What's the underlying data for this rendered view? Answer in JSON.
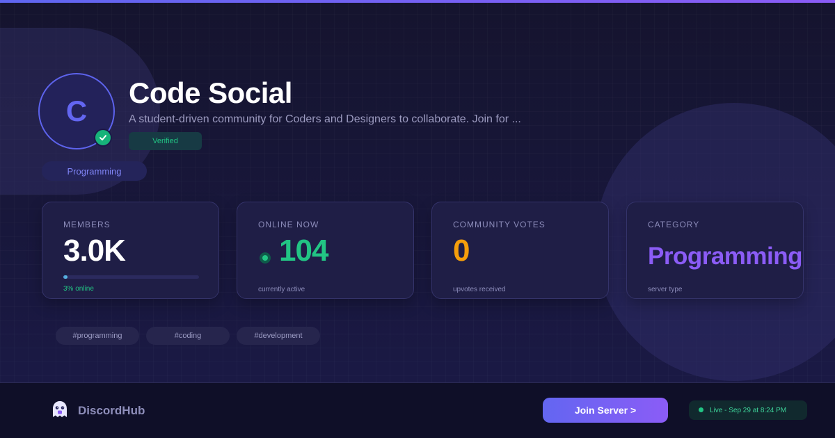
{
  "server": {
    "avatar_letter": "C",
    "name": "Code Social",
    "description": "A student-driven community for Coders and Designers to collaborate. Join for ...",
    "verified_label": "Verified",
    "category_pill": "Programming"
  },
  "stats": {
    "members": {
      "label": "MEMBERS",
      "value": "3.0K",
      "sub": "3% online",
      "online_fraction": 0.03
    },
    "online": {
      "label": "ONLINE NOW",
      "value": "104",
      "sub": "currently active"
    },
    "votes": {
      "label": "COMMUNITY VOTES",
      "value": "0",
      "sub": "upvotes received"
    },
    "category": {
      "label": "CATEGORY",
      "value": "Programming",
      "sub": "server type"
    }
  },
  "tags": [
    "#programming",
    "#coding",
    "#development"
  ],
  "footer": {
    "brand_name": "DiscordHub",
    "join_label": "Join Server >",
    "live_text": "Live - Sep 29 at 8:24 PM"
  },
  "colors": {
    "accent": "#6366f1",
    "accent_purple": "#8b5cf6",
    "online_green": "#22c584",
    "votes_orange": "#f59e0b",
    "category_purple": "#8b5cf6"
  },
  "icons": {
    "verified": "check-icon",
    "brand": "ghost-mascot-icon",
    "online": "status-dot-icon"
  }
}
